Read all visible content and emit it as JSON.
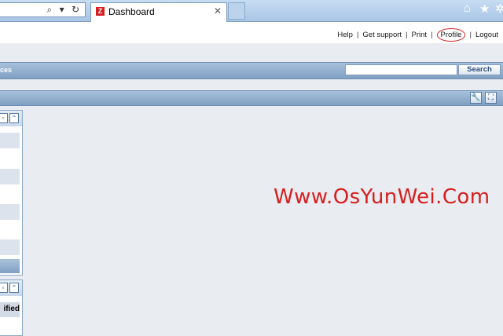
{
  "browser": {
    "tab_title": "Dashboard",
    "tab_favicon": "Z",
    "address_icons": "⌕ ▾ ↻",
    "tab_close": "✕",
    "icons": [
      "search-icon",
      "refresh-icon",
      "close-icon",
      "home-icon",
      "star-icon",
      "gear-icon"
    ]
  },
  "toplinks": {
    "help": "Help",
    "support": "Get support",
    "print": "Print",
    "profile": "Profile",
    "logout": "Logout",
    "separator": "|"
  },
  "menubar": {
    "label_fragment": "ces"
  },
  "search": {
    "value": "",
    "button_label": "Search"
  },
  "widgets": {
    "second_header_fragment": "ified"
  },
  "watermark": {
    "text": "Www.OsYunWei.Com",
    "color": "#d81e1e"
  },
  "colors": {
    "bar_blue": "#7f9fc2",
    "page_bg": "#e9edf1",
    "highlight_circle": "#d42020"
  }
}
